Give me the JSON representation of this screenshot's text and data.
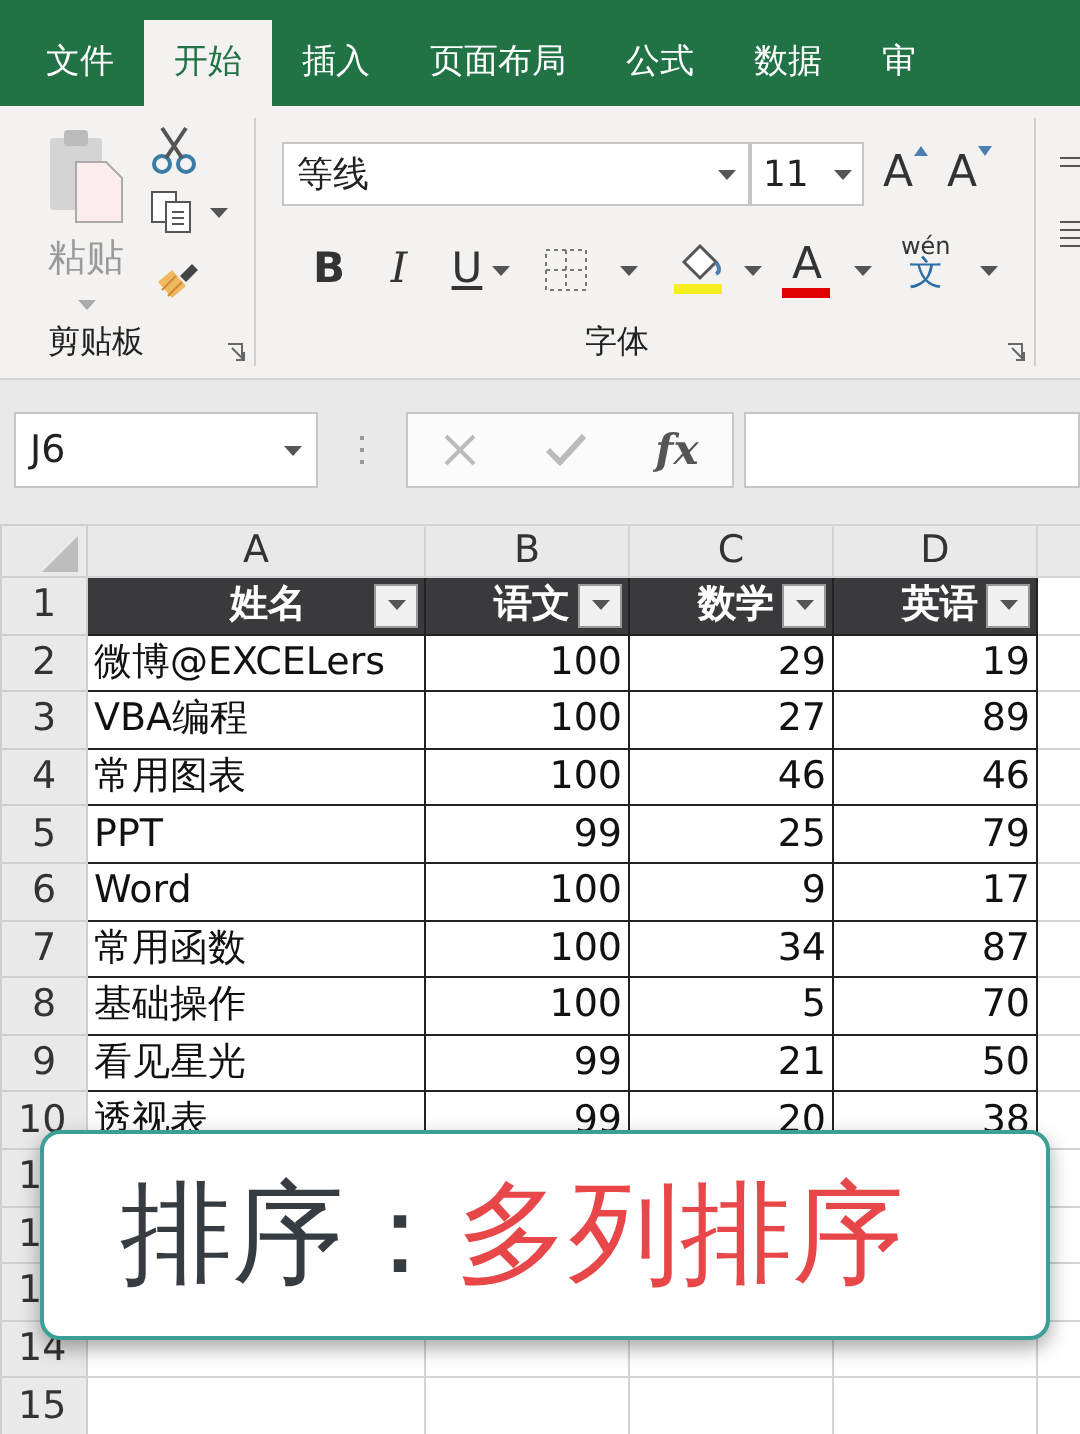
{
  "menu_tabs": [
    {
      "label": "文件",
      "selected": false
    },
    {
      "label": "开始",
      "selected": true
    },
    {
      "label": "插入",
      "selected": false
    },
    {
      "label": "页面布局",
      "selected": false
    },
    {
      "label": "公式",
      "selected": false
    },
    {
      "label": "数据",
      "selected": false
    },
    {
      "label": "审",
      "selected": false
    }
  ],
  "clipboard": {
    "paste_label": "粘贴",
    "group_label": "剪贴板"
  },
  "font_group": {
    "font_name": "等线",
    "font_size": "11",
    "grow_label": "A",
    "shrink_label": "A",
    "format_buttons": [
      "B",
      "I",
      "U"
    ],
    "font_color_label": "A",
    "phonetic_top": "wén",
    "phonetic_bottom": "文",
    "group_label": "字体"
  },
  "formula_bar": {
    "name_box": "J6",
    "function_label": "fx"
  },
  "columns": [
    "A",
    "B",
    "C",
    "D"
  ],
  "header_row": [
    "姓名",
    "语文",
    "数学",
    "英语"
  ],
  "rows": [
    [
      "微博@EXCELers",
      "100",
      "29",
      "19"
    ],
    [
      "VBA编程",
      "100",
      "27",
      "89"
    ],
    [
      "常用图表",
      "100",
      "46",
      "46"
    ],
    [
      "PPT",
      "99",
      "25",
      "79"
    ],
    [
      "Word",
      "100",
      "9",
      "17"
    ],
    [
      "常用函数",
      "100",
      "34",
      "87"
    ],
    [
      "基础操作",
      "100",
      "5",
      "70"
    ],
    [
      "看见星光",
      "99",
      "21",
      "50"
    ],
    [
      "透视表",
      "99",
      "20",
      "38"
    ]
  ],
  "row_numbers": [
    "1",
    "2",
    "3",
    "4",
    "5",
    "6",
    "7",
    "8",
    "9",
    "10",
    "1",
    "1",
    "1",
    "14",
    "15"
  ],
  "caption": {
    "label": "排序：",
    "value": "多列排序"
  }
}
